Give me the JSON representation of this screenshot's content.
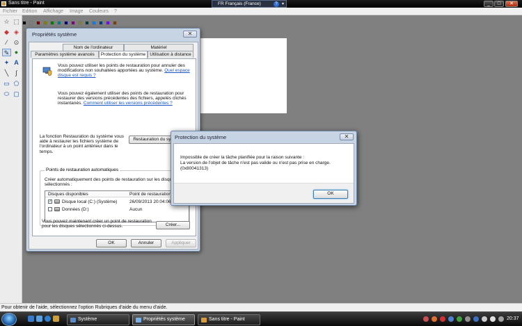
{
  "paint": {
    "title": "Sans titre - Paint",
    "menu": [
      "Fichier",
      "Edition",
      "Affichage",
      "Image",
      "Couleurs",
      "?"
    ],
    "language": "FR Français (France)",
    "palette": [
      "#000000",
      "#808080",
      "#800000",
      "#808000",
      "#008000",
      "#008080",
      "#000080",
      "#800080",
      "#808040",
      "#004040",
      "#0080ff",
      "#004080",
      "#8000ff",
      "#804000",
      "#ffffff",
      "#c0c0c0",
      "#ff0000",
      "#ffff00",
      "#00ff00",
      "#00ffff",
      "#0000ff",
      "#ff00ff",
      "#ffff80",
      "#00ff80",
      "#80ffff",
      "#8080ff",
      "#ff0080",
      "#ff8040"
    ],
    "status_text": "Pour obtenir de l'aide, sélectionnez l'option Rubriques d'aide du menu d'aide."
  },
  "sysprop": {
    "title": "Propriétés système",
    "tabs_row1": [
      "Nom de l'ordinateur",
      "Matériel"
    ],
    "tabs_row2": [
      "Paramètres système avancés",
      "Protection du système",
      "Utilisation à distance"
    ],
    "intro_text": "Vous pouvez utiliser les points de restauration pour annuler des modifications non souhaitées apportées au système.",
    "intro_link": "Quel espace disque est requis ?",
    "shadow_text": "Vous pouvez également utiliser des points de restauration pour restaurer des versions précédentes des fichiers, appelés clichés instantanés.",
    "shadow_link": "Comment utiliser les versions précédentes ?",
    "restore_text": "La fonction Restauration du système vous aide à restaurer les fichiers système de l'ordinateur à un point antérieur dans le temps.",
    "restore_button": "Restauration du système...",
    "group_title": "Points de restauration automatiques",
    "group_text": "Créer automatiquement des points de restauration sur les disques sélectionnés :",
    "columns": [
      "Disques disponibles",
      "Point de restauration"
    ],
    "disks": [
      {
        "name": "Disque local (C:) (Système)",
        "point": "26/09/2013 20:04:06",
        "checked": true
      },
      {
        "name": "Données (D:)",
        "point": "Aucun",
        "checked": false
      }
    ],
    "create_text": "Vous pouvez maintenant créer un point de restauration pour les disques sélectionnés ci-dessus.",
    "create_button": "Créer...",
    "ok": "OK",
    "cancel": "Annuler",
    "apply": "Appliquer"
  },
  "error_dialog": {
    "title": "Protection du système",
    "line1": "Impossible de créer la tâche planifiée pour la raison suivante :",
    "line2": "La version de l'objet de tâche n'est pas valide ou n'est pas prise en charge.",
    "line3": "(0x80041313)",
    "ok": "OK"
  },
  "taskbar": {
    "items": [
      "Système",
      "Propriétés système",
      "Sans titre - Paint"
    ],
    "clock": "20:37"
  }
}
